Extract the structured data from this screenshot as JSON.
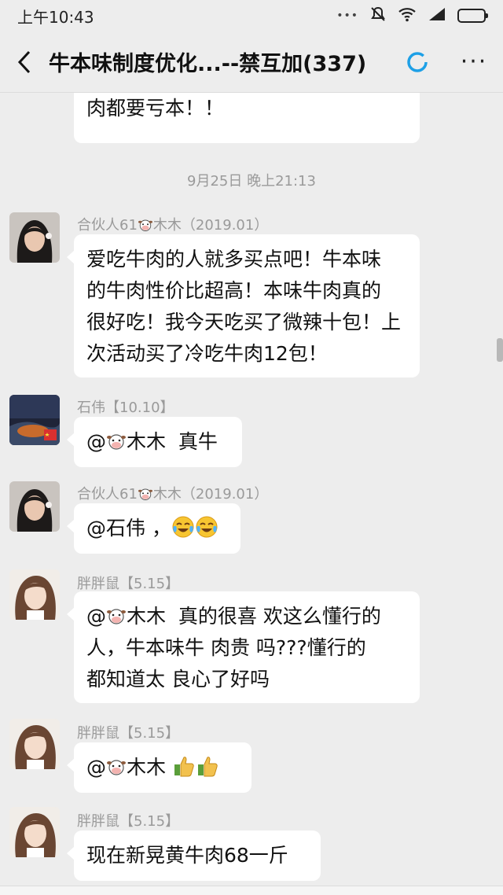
{
  "status_bar": {
    "time": "上午10:43",
    "icons": [
      "dots-icon",
      "mute-icon",
      "wifi-icon",
      "signal-icon",
      "battery-icon"
    ]
  },
  "header": {
    "title": "牛本味制度优化...--禁互加(337)",
    "back_icon": "chevron-left-icon",
    "sync_icon": "sync-ring-icon",
    "more_icon": "more-dots-icon",
    "more_label": "···"
  },
  "messages": [
    {
      "type": "partial",
      "lines": [
        "肉都要亏本！！"
      ]
    },
    {
      "type": "timestamp",
      "text": "9月25日 晚上21:13"
    },
    {
      "type": "message",
      "sender_prefix": "合伙人61",
      "sender_suffix": "木木（2019.01）",
      "lines": [
        "爱吃牛肉的人就多买点吧！牛本味",
        "的牛肉性价比超高！本味牛肉真的",
        "很好吃！我今天吃买了微辣十包！上",
        "次活动买了冷吃牛肉12包！"
      ]
    },
    {
      "type": "message",
      "sender": "石伟【10.10】",
      "prefix": "@",
      "text": "木木  真牛"
    },
    {
      "type": "message",
      "sender_prefix": "合伙人61",
      "sender_suffix": "木木（2019.01）",
      "text": "@石伟 ，"
    },
    {
      "type": "message",
      "sender": "胖胖鼠【5.15】",
      "prefix": "@",
      "first_line": "木木  真的很喜 欢这么懂行的",
      "lines": [
        "人，牛本味牛 肉贵 吗???懂行的",
        "都知道太 良心了好吗"
      ]
    },
    {
      "type": "message",
      "sender": "胖胖鼠【5.15】",
      "prefix": "@",
      "text": "木木 "
    },
    {
      "type": "message",
      "sender": "胖胖鼠【5.15】",
      "text": "现在新晃黄牛肉68一斤"
    }
  ],
  "colors": {
    "background": "#ededed",
    "bubble": "#ffffff",
    "meta_text": "#9a9a9a",
    "sync_ring": "#1ea0e6"
  }
}
